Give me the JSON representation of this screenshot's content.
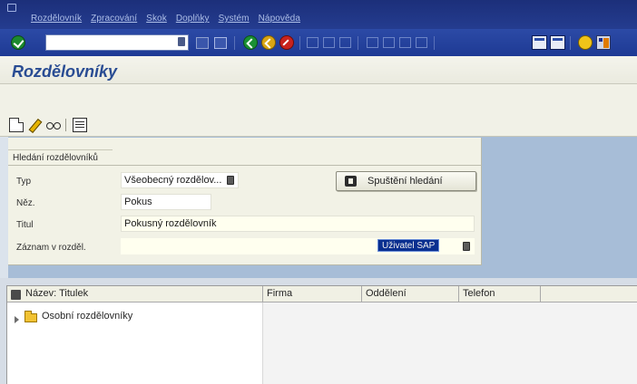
{
  "menu": [
    "Rozdělovník",
    "Zpracování",
    "Skok",
    "Doplňky",
    "Systém",
    "Nápověda"
  ],
  "toolbar": {
    "command_value": ""
  },
  "title": "Rozdělovníky",
  "search": {
    "group_label": "Hledání rozdělovníků",
    "button_label": "Spuštění hledání",
    "fields": [
      {
        "label": "Typ",
        "value": "Všeobecný rozdělov..."
      },
      {
        "label": "Něz.",
        "value": "Pokus"
      },
      {
        "label": "Titul",
        "value": "Pokusný rozdělovník"
      },
      {
        "label": "Záznam v rozděl.",
        "value": "Uživatel SAP"
      }
    ]
  },
  "list": {
    "columns": [
      "Název: Titulek",
      "Firma",
      "Oddělení",
      "Telefon"
    ],
    "rows": [
      {
        "label": "Osobní rozdělovníky"
      }
    ]
  }
}
